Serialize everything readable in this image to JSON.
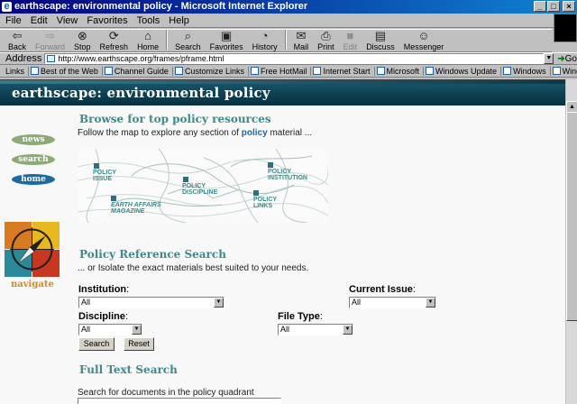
{
  "window": {
    "title": "earthscape: environmental policy - Microsoft Internet Explorer",
    "btn_min": "_",
    "btn_max": "□",
    "btn_close": "×"
  },
  "menu": {
    "items": [
      "File",
      "Edit",
      "View",
      "Favorites",
      "Tools",
      "Help"
    ]
  },
  "toolbar": {
    "back": "Back",
    "forward": "Forward",
    "stop": "Stop",
    "refresh": "Refresh",
    "home": "Home",
    "search": "Search",
    "favorites": "Favorites",
    "history": "History",
    "mail": "Mail",
    "print": "Print",
    "edit": "Edit",
    "discuss": "Discuss",
    "messenger": "Messenger"
  },
  "address": {
    "label": "Address",
    "url": "http://www.earthscape.org/frames/pframe.html",
    "go": "Go"
  },
  "links": {
    "label": "Links",
    "items": [
      "Best of the Web",
      "Channel Guide",
      "Customize Links",
      "Free HotMail",
      "Internet Start",
      "Microsoft",
      "Windows Update",
      "Windows",
      "Windows Media"
    ]
  },
  "page": {
    "banner_title": "earthscape: environmental policy",
    "nav": {
      "news": "news",
      "search": "search",
      "home": "home",
      "navigate": "navigate"
    },
    "browse": {
      "heading": "Browse for top policy resources",
      "text_before": "Follow the map to explore any section of ",
      "text_highlight": "policy",
      "text_after": " material ..."
    },
    "map": {
      "policy_issue": [
        "POLICY",
        "ISSUE"
      ],
      "earth_affairs": [
        "EARTH AFFAIRS",
        "MAGAZINE"
      ],
      "policy_discipline": [
        "POLICY",
        "DISCIPLINE"
      ],
      "policy_institution": [
        "POLICY",
        "INSTITUTION"
      ],
      "policy_links": [
        "POLICY",
        "LINKS"
      ]
    },
    "reference": {
      "heading": "Policy Reference Search",
      "text": "... or Isolate the exact materials best suited to your needs.",
      "institution_label": "Institution",
      "institution_value": "All",
      "current_issue_label": "Current Issue",
      "current_issue_value": "All",
      "discipline_label": "Discipline",
      "discipline_value": "All",
      "file_type_label": "File Type",
      "file_type_value": "All",
      "colon": ":",
      "search_btn": "Search",
      "reset_btn": "Reset"
    },
    "fulltext": {
      "heading": "Full Text Search",
      "text": "Search for documents in the policy quadrant"
    }
  },
  "colors": {
    "banner": "#0e3e50",
    "heading_teal": "#3e8a88",
    "link_blue": "#1c6aa0",
    "navigate_orange": "#d08a20"
  }
}
